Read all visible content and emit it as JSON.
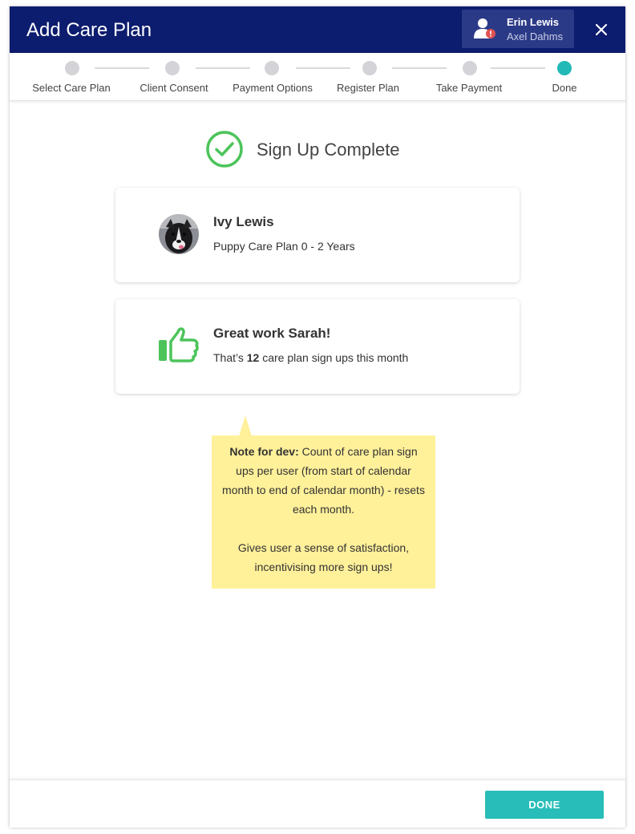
{
  "header": {
    "title": "Add Care Plan",
    "user": {
      "primary_name": "Erin Lewis",
      "secondary_name": "Axel Dahms",
      "icon": "user-alert-icon"
    },
    "close_icon": "close-icon"
  },
  "stepper": {
    "steps": [
      {
        "label": "Select Care Plan",
        "state": "complete"
      },
      {
        "label": "Client Consent",
        "state": "complete"
      },
      {
        "label": "Payment Options",
        "state": "complete"
      },
      {
        "label": "Register Plan",
        "state": "complete"
      },
      {
        "label": "Take Payment",
        "state": "complete"
      },
      {
        "label": "Done",
        "state": "active"
      }
    ],
    "active_color": "#22b9b7",
    "inactive_color": "#d4d4d8"
  },
  "status": {
    "title": "Sign Up Complete",
    "icon": "check-circle-icon",
    "color": "#4cc45a"
  },
  "pet_card": {
    "name": "Ivy Lewis",
    "plan": "Puppy Care Plan 0 - 2 Years",
    "avatar": "dog-photo-avatar"
  },
  "kudos_card": {
    "heading": "Great work Sarah!",
    "text_before": "That’s ",
    "count": "12",
    "text_after": " care plan sign ups this month",
    "icon": "thumbs-up-icon"
  },
  "dev_note": {
    "label": "Note for dev:",
    "body": " Count of care plan sign ups per user (from start of calendar month to end of calendar month) - resets each month.",
    "body2": "Gives user a sense of satisfaction, incentivising more sign ups!"
  },
  "footer": {
    "done_label": "DONE"
  },
  "colors": {
    "header_bg": "#0c1c6e",
    "accent": "#28bdb9",
    "note_bg": "#fff09a"
  }
}
